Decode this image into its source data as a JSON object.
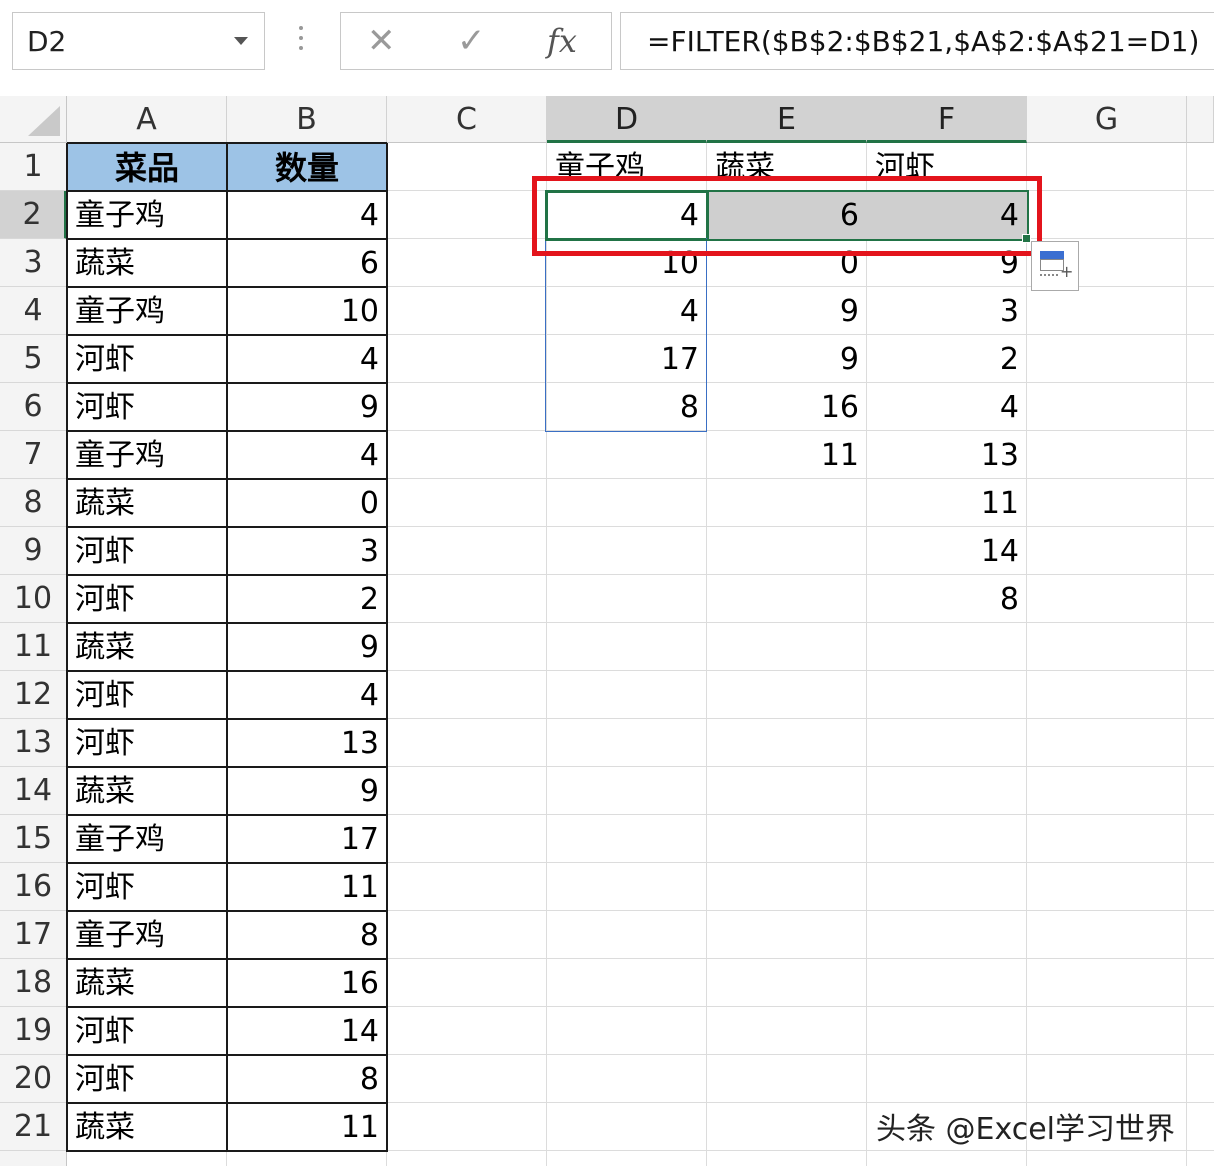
{
  "name_box": "D2",
  "formula_bar": {
    "cancel_icon": "✕",
    "enter_icon": "✓",
    "fx_label": "fx",
    "formula": "=FILTER($B$2:$B$21,$A$2:$A$21=D1)"
  },
  "columns": [
    "A",
    "B",
    "C",
    "D",
    "E",
    "F",
    "G"
  ],
  "rows": [
    "1",
    "2",
    "3",
    "4",
    "5",
    "6",
    "7",
    "8",
    "9",
    "10",
    "11",
    "12",
    "13",
    "14",
    "15",
    "16",
    "17",
    "18",
    "19",
    "20",
    "21"
  ],
  "selected_column_headers": [
    "D",
    "E",
    "F"
  ],
  "selected_row_header": "2",
  "source_table": {
    "headers": [
      "菜品",
      "数量"
    ],
    "rows": [
      [
        "童子鸡",
        "4"
      ],
      [
        "蔬菜",
        "6"
      ],
      [
        "童子鸡",
        "10"
      ],
      [
        "河虾",
        "4"
      ],
      [
        "河虾",
        "9"
      ],
      [
        "童子鸡",
        "4"
      ],
      [
        "蔬菜",
        "0"
      ],
      [
        "河虾",
        "3"
      ],
      [
        "河虾",
        "2"
      ],
      [
        "蔬菜",
        "9"
      ],
      [
        "河虾",
        "4"
      ],
      [
        "河虾",
        "13"
      ],
      [
        "蔬菜",
        "9"
      ],
      [
        "童子鸡",
        "17"
      ],
      [
        "河虾",
        "11"
      ],
      [
        "童子鸡",
        "8"
      ],
      [
        "蔬菜",
        "16"
      ],
      [
        "河虾",
        "14"
      ],
      [
        "河虾",
        "8"
      ],
      [
        "蔬菜",
        "11"
      ]
    ]
  },
  "filter_results": {
    "headers": [
      "童子鸡",
      "蔬菜",
      "河虾"
    ],
    "columns": [
      [
        "4",
        "10",
        "4",
        "17",
        "8"
      ],
      [
        "6",
        "0",
        "9",
        "9",
        "16",
        "11"
      ],
      [
        "4",
        "9",
        "3",
        "2",
        "4",
        "13",
        "11",
        "14",
        "8"
      ]
    ]
  },
  "highlight_color": "#e3141c",
  "header_fill_color": "#9dc3e6",
  "watermark": "头条 @Excel学习世界"
}
